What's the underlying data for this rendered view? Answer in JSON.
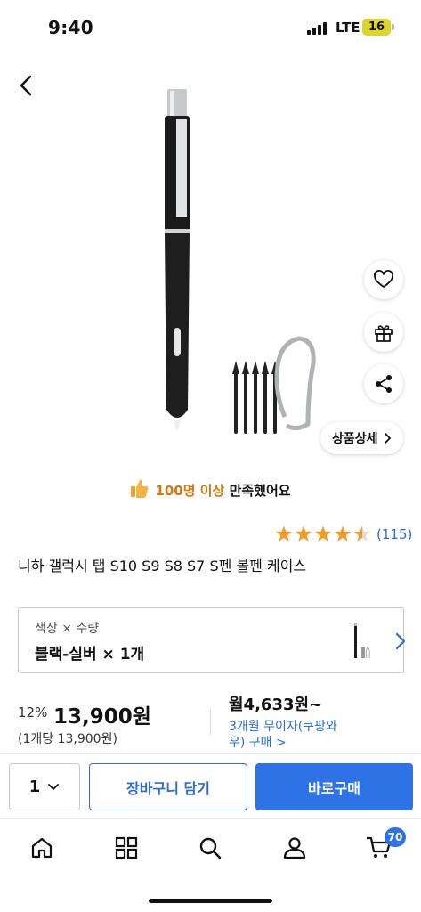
{
  "status_bar": {
    "time": "9:40",
    "network": "LTE",
    "battery": "16"
  },
  "satisfaction": {
    "highlight": "100명 이상",
    "rest": " 만족했어요"
  },
  "detail_button": "상품상세",
  "rating": {
    "stars": 4.5,
    "count": "(115)"
  },
  "product": {
    "title": "니하 갤럭시 탭 S10 S9 S8 S7 S펜 볼펜 케이스"
  },
  "option": {
    "label": "색상 × 수량",
    "value": "블랙-실버 × 1개"
  },
  "price": {
    "discount": "12%",
    "amount": "13,900원",
    "unit_price": "(1개당 13,900원)",
    "monthly": "월4,633원~",
    "monthly_desc": "3개월 무이자(쿠팡와우) 구매 >"
  },
  "purchase": {
    "quantity": "1",
    "cart_label": "장바구니 담기",
    "buy_label": "바로구매"
  },
  "tab_bar": {
    "items": [
      "home-icon",
      "category-icon",
      "search-icon",
      "user-icon",
      "cart-icon"
    ],
    "cart_badge": "70"
  },
  "colors": {
    "accent": "#2d73e6",
    "star": "#f39c2b",
    "highlight": "#d6760b"
  }
}
